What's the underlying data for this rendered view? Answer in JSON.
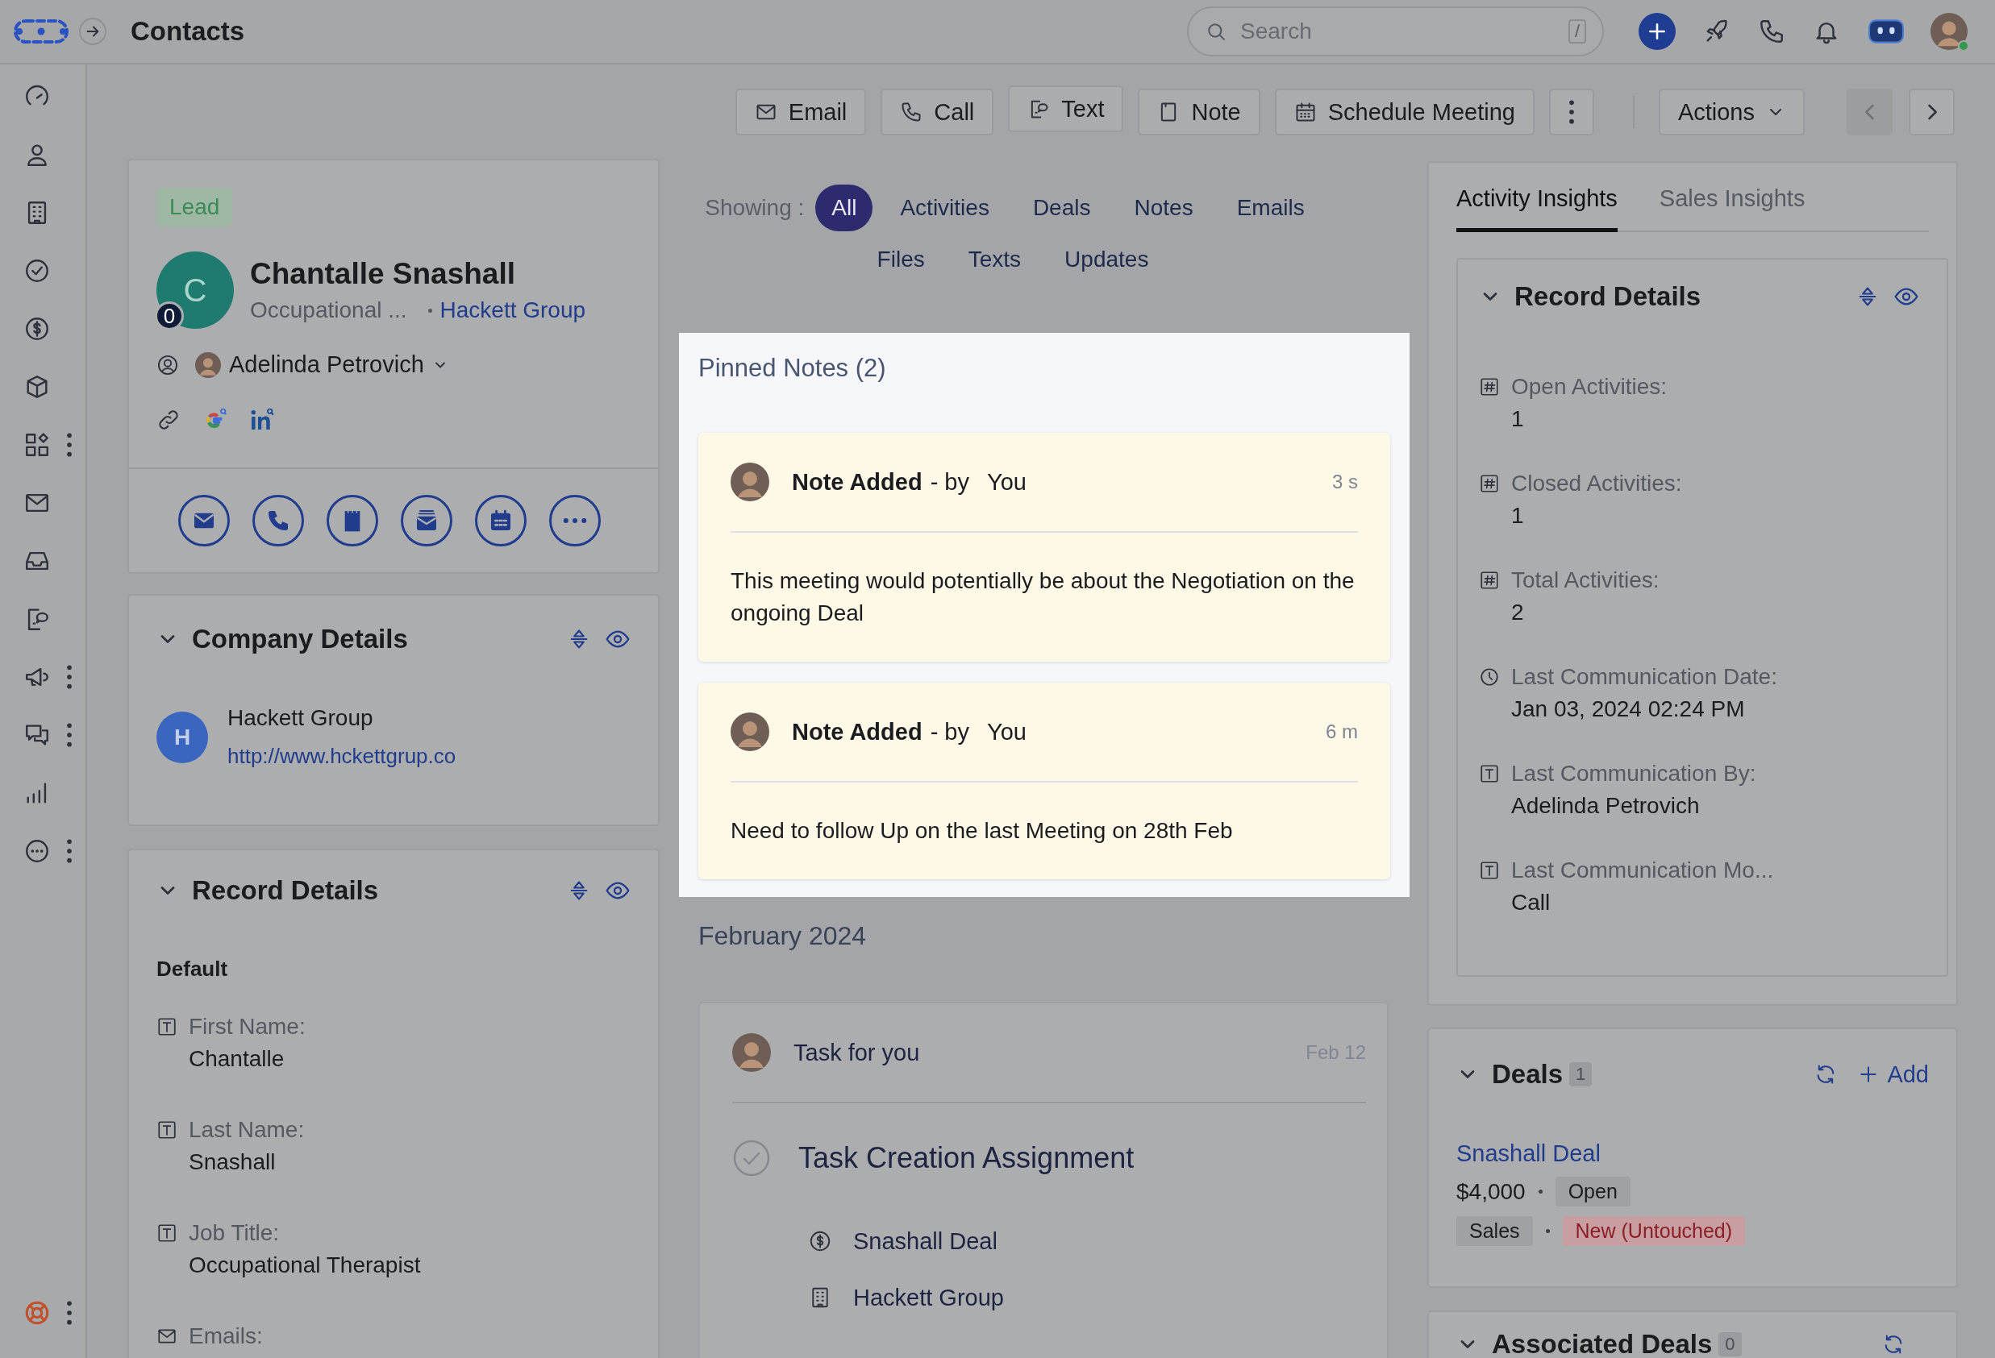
{
  "header": {
    "title": "Contacts",
    "search": {
      "placeholder": "Search",
      "shortcut": "/"
    },
    "user": {
      "online": true
    }
  },
  "toolbar": {
    "buttons": [
      {
        "label": "Email"
      },
      {
        "label": "Call"
      },
      {
        "label": "Text"
      },
      {
        "label": "Note"
      },
      {
        "label": "Schedule Meeting"
      }
    ],
    "actions": "Actions",
    "pager": [
      {
        "disabled": true
      },
      {
        "disabled": false
      }
    ]
  },
  "contact": {
    "status": "Lead",
    "initial": "C",
    "badge": "0",
    "name": "Chantalle Snashall",
    "job": "Occupational ...",
    "company": "Hackett Group",
    "owner": "Adelinda Petrovich"
  },
  "company_details": {
    "title": "Company Details",
    "initial": "H",
    "name": "Hackett Group",
    "url": "http://www.hckettgrup.co"
  },
  "record_details": {
    "title": "Record Details",
    "group": "Default",
    "fields": [
      {
        "kind": "text",
        "label": "First Name:",
        "value": "Chantalle"
      },
      {
        "kind": "text",
        "label": "Last Name:",
        "value": "Snashall"
      },
      {
        "kind": "text",
        "label": "Job Title:",
        "value": "Occupational Therapist"
      },
      {
        "kind": "email",
        "label": "Emails:"
      }
    ]
  },
  "activity": {
    "showing_label": "Showing :",
    "filters": [
      {
        "label": "All",
        "selected": true
      },
      {
        "label": "Activities",
        "selected": false
      },
      {
        "label": "Deals",
        "selected": false
      },
      {
        "label": "Notes",
        "selected": false
      },
      {
        "label": "Emails",
        "selected": false
      },
      {
        "label": "Files",
        "selected": false
      },
      {
        "label": "Texts",
        "selected": false
      },
      {
        "label": "Updates",
        "selected": false
      }
    ],
    "pinned": {
      "title": "Pinned Notes (2)",
      "notes": [
        {
          "title": "Note Added",
          "by": "- by",
          "author": "You",
          "time": "3 s",
          "body": "This meeting would potentially be about the Negotiation on the ongoing Deal"
        },
        {
          "title": "Note Added",
          "by": "- by",
          "author": "You",
          "time": "6 m",
          "body": "Need to follow Up on the last Meeting on 28th Feb"
        }
      ]
    },
    "month": "February 2024",
    "task": {
      "title": "Task for you",
      "time": "Feb 12",
      "name": "Task Creation Assignment",
      "links": [
        {
          "kind": "deal",
          "label": "Snashall Deal"
        },
        {
          "kind": "company",
          "label": "Hackett Group"
        }
      ]
    }
  },
  "insights": {
    "tabs": [
      {
        "label": "Activity Insights",
        "selected": true
      },
      {
        "label": "Sales Insights",
        "selected": false
      }
    ],
    "record_details": {
      "title": "Record Details",
      "fields": [
        {
          "kind": "number",
          "label": "Open Activities:",
          "value": "1"
        },
        {
          "kind": "number",
          "label": "Closed Activities:",
          "value": "1"
        },
        {
          "kind": "number",
          "label": "Total Activities:",
          "value": "2"
        },
        {
          "kind": "date",
          "label": "Last Communication Date:",
          "value": "Jan 03, 2024 02:24 PM"
        },
        {
          "kind": "text",
          "label": "Last Communication By:",
          "value": "Adelinda Petrovich"
        },
        {
          "kind": "text",
          "label": "Last Communication Mo...",
          "value": "Call"
        }
      ]
    }
  },
  "deals": {
    "title": "Deals",
    "count": "1",
    "add": "Add",
    "items": [
      {
        "name": "Snashall Deal",
        "amount": "$4,000",
        "status": "Open",
        "pipeline": "Sales",
        "stage": "New (Untouched)"
      }
    ]
  },
  "associated_deals": {
    "title": "Associated Deals",
    "count": "0"
  }
}
